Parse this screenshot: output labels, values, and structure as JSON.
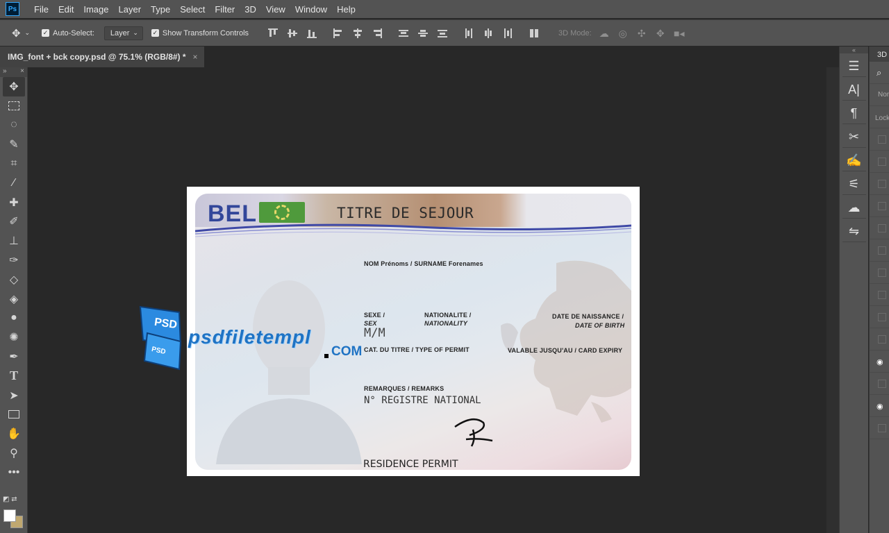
{
  "app": {
    "logo": "Ps"
  },
  "menu": [
    "File",
    "Edit",
    "Image",
    "Layer",
    "Type",
    "Select",
    "Filter",
    "3D",
    "View",
    "Window",
    "Help"
  ],
  "options": {
    "auto_select_label": "Auto-Select:",
    "auto_select_checked": true,
    "layer_dropdown": "Layer",
    "show_transform_label": "Show Transform Controls",
    "mode_label": "3D Mode:"
  },
  "document_tab": {
    "title": "IMG_font + bck copy.psd @ 75.1% (RGB/8#) *",
    "close": "×"
  },
  "toolbar": {
    "collapse": "»",
    "close": "×"
  },
  "right_panel": {
    "collapse": "«",
    "tab": "3D",
    "search_icon": "⌕",
    "filter": "Nor",
    "lock_label": "Lock"
  },
  "card": {
    "country": "BEL",
    "title": "TITRE DE SEJOUR",
    "name_label": "NOM Prénoms / SURNAME Forenames",
    "sex_label_fr": "SEXE /",
    "sex_label_en": "SEX",
    "nationality_label_fr": "NATIONALITE /",
    "nationality_label_en": "NATIONALITY",
    "dob_label_fr": "DATE DE NAISSANCE /",
    "dob_label_en": "DATE OF BIRTH",
    "sex_value": "M/M",
    "permit_type_label": "CAT. DU TITRE / TYPE OF PERMIT",
    "expiry_label": "VALABLE JUSQU'AU / CARD EXPIRY",
    "remarks_label": "REMARQUES / REMARKS",
    "registry_label": "N° REGISTRE NATIONAL",
    "footer": "RESIDENCE PERMIT"
  },
  "watermark": {
    "badge1": "PSD",
    "badge2": "PSD",
    "text": "psdfiletempl",
    "domain": "COM"
  }
}
